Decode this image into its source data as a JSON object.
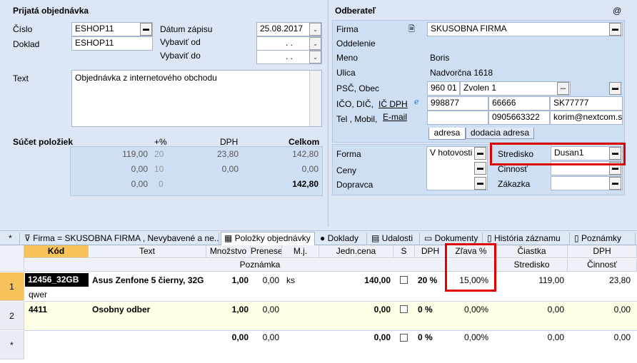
{
  "order": {
    "title": "Prijatá objednávka",
    "cislo_label": "Číslo",
    "cislo": "ESHOP11",
    "doklad_label": "Doklad",
    "doklad": "ESHOP11",
    "datum_label": "Dátum zápisu",
    "datum": "25.08.2017",
    "vybavit_od_label": "Vybaviť od",
    "vybavit_od": ". .",
    "vybavit_do_label": "Vybaviť do",
    "vybavit_do": ". .",
    "text_label": "Text",
    "text": "Objednávka z internetového obchodu"
  },
  "summary": {
    "title": "Súčet položiek",
    "col_pct": "+%",
    "col_dph": "DPH",
    "col_celkom": "Celkom",
    "rows": [
      {
        "base": "119,00",
        "pct": "20",
        "dph": "23,80",
        "celkom": "142,80"
      },
      {
        "base": "0,00",
        "pct": "10",
        "dph": "0,00",
        "celkom": "0,00"
      },
      {
        "base": "0,00",
        "pct": "0",
        "dph": "",
        "celkom": "142,80"
      }
    ]
  },
  "customer": {
    "title": "Odberateľ",
    "at": "@",
    "firma_label": "Firma",
    "firma": "SKUSOBNA FIRMA",
    "oddelenie_label": "Oddelenie",
    "meno_label": "Meno",
    "meno": "Boris",
    "ulica_label": "Ulica",
    "ulica": "Nadvorčna 1618",
    "psc_label": "PSČ, Obec",
    "psc": "960 01",
    "obec": "Zvolen 1",
    "ico_label": "IČO, DIČ,",
    "icdph_label": "IČ DPH",
    "ico": "998877",
    "dic": "66666",
    "icdph": "SK77777",
    "tel_label": "Tel , Mobil,",
    "email_label": "E-mail",
    "mobil": "0905663322",
    "email": "korim@nextcom.s",
    "tab_adresa": "adresa",
    "tab_dodacia": "dodacia adresa"
  },
  "extra": {
    "forma_label": "Forma",
    "forma": "V hotovosti",
    "ceny_label": "Ceny",
    "dopravca_label": "Dopravca",
    "stredisko_label": "Stredisko",
    "stredisko": "Dusan1",
    "cinnost_label": "Činnosť",
    "zakazka_label": "Zákazka"
  },
  "tabs": {
    "star": "*",
    "filter": "Firma = SKUSOBNA FIRMA , Nevybavené a ne...",
    "polozky": "Položky objednávky",
    "doklady": "Doklady",
    "udalosti": "Udalosti",
    "dokumenty": "Dokumenty",
    "historia": "História záznamu",
    "poznamky": "Poznámky"
  },
  "grid": {
    "headers": {
      "kod": "Kód",
      "text": "Text",
      "mnozstvo": "Množstvo",
      "prenesene": "Prenesei",
      "mj": "M.j.",
      "jedn_cena": "Jedn.cena",
      "s": "S",
      "dph": "DPH",
      "zlava": "Zľava %",
      "ciastka": "Čiastka",
      "dph2": "DPH",
      "poznamka": "Poznámka",
      "stredisko": "Stredisko",
      "cinnost": "Činnosť"
    },
    "rows": [
      {
        "num": "1",
        "kod": "12456_32GB",
        "text": "Asus Zenfone 5 čierny, 32G",
        "mnozstvo": "1,00",
        "prenesene": "0,00",
        "mj": "ks",
        "jedn_cena": "140,00",
        "dph": "20 %",
        "zlava": "15,00%",
        "ciastka": "119,00",
        "dph2": "23,80",
        "poznamka": "qwer"
      },
      {
        "num": "2",
        "kod": "4411",
        "text": "Osobny odber",
        "mnozstvo": "1,00",
        "prenesene": "0,00",
        "mj": "",
        "jedn_cena": "0,00",
        "dph": "0 %",
        "zlava": "0,00%",
        "ciastka": "0,00",
        "dph2": "0,00",
        "poznamka": ""
      },
      {
        "num": "*",
        "kod": "",
        "text": "",
        "mnozstvo": "0,00",
        "prenesene": "0,00",
        "mj": "",
        "jedn_cena": "0,00",
        "dph": "0 %",
        "zlava": "0,00%",
        "ciastka": "0,00",
        "dph2": "0,00",
        "poznamka": ""
      }
    ]
  },
  "colors": {
    "highlight": "#e00000",
    "selected_row": "#ffffe6",
    "kod_header": "#f7c25a"
  }
}
